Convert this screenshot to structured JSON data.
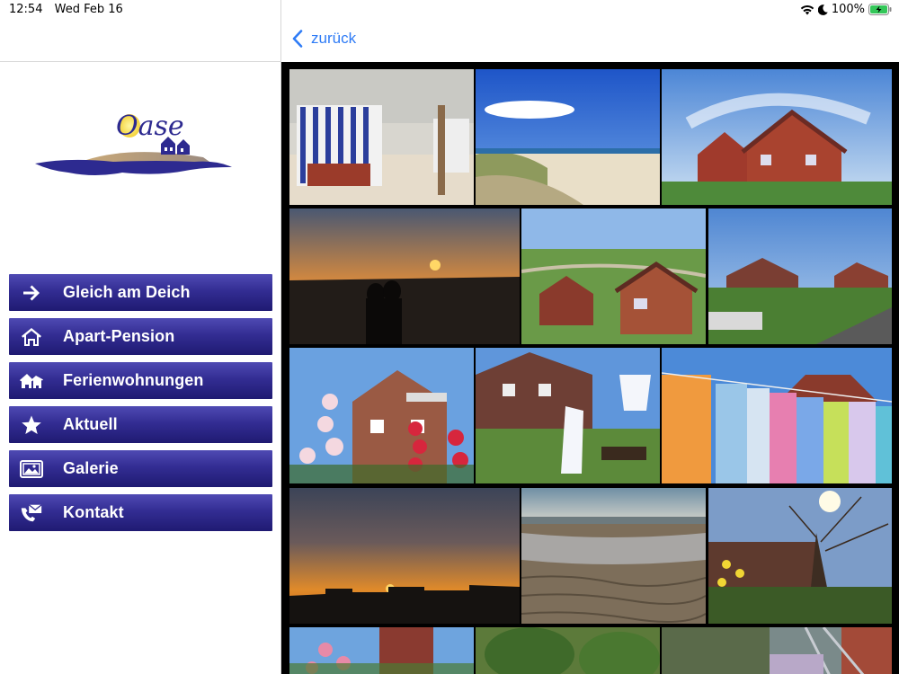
{
  "status": {
    "time": "12:54",
    "date": "Wed Feb 16",
    "battery": "100%"
  },
  "header": {
    "back_label": "zurück"
  },
  "logo": {
    "text": "Oase"
  },
  "nav": {
    "items": [
      {
        "label": "Gleich am Deich",
        "icon": "arrow-right-icon"
      },
      {
        "label": "Apart-Pension",
        "icon": "house-icon"
      },
      {
        "label": "Ferienwohnungen",
        "icon": "houses-icon"
      },
      {
        "label": "Aktuell",
        "icon": "star-icon"
      },
      {
        "label": "Galerie",
        "icon": "gallery-icon"
      },
      {
        "label": "Kontakt",
        "icon": "contact-icon"
      }
    ]
  },
  "colors": {
    "accent": "#2f7cf6",
    "nav_gradient_top": "#4f4ab3",
    "nav_gradient_bottom": "#1f1a72",
    "battery_green": "#34c759"
  },
  "gallery": {
    "photos": [
      "beach-chairs",
      "dunes-seagull",
      "red-brick-house-rainbow",
      "sunset-couple",
      "aerial-houses-dike",
      "guesthouse-meadow",
      "hollyhocks-house",
      "laundry-garden",
      "colorful-laundry",
      "orange-sunset-skyline",
      "mudflats-beach",
      "daffodils-tree",
      "garden-roses",
      "green-hedge",
      "balcony-view"
    ]
  }
}
